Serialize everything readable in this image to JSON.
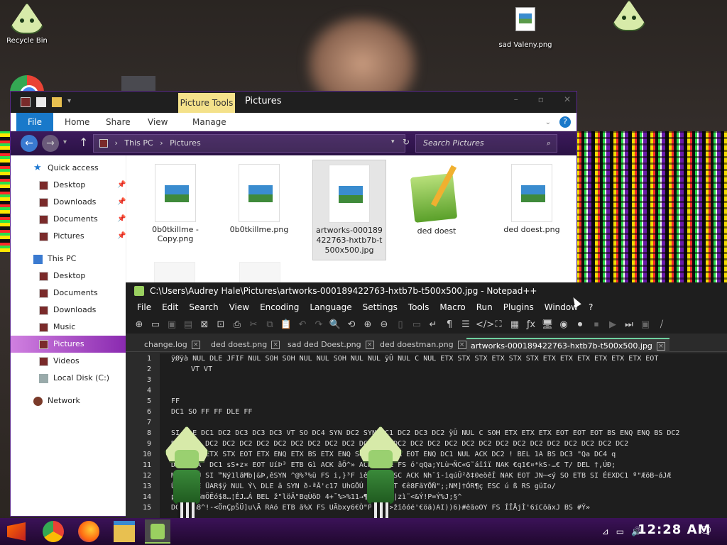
{
  "desktop": {
    "icons": [
      {
        "label": "Recycle Bin"
      },
      {
        "label": "sad Valeny.png"
      }
    ]
  },
  "explorer": {
    "ribbon_context_tab": "Picture Tools",
    "title": "Pictures",
    "ribbon_tabs": {
      "file": "File",
      "home": "Home",
      "share": "Share",
      "view": "View",
      "manage": "Manage"
    },
    "breadcrumb": {
      "this_pc": "This PC",
      "separator": "›",
      "pictures": "Pictures"
    },
    "search_placeholder": "Search Pictures",
    "nav": {
      "quick_access": "Quick access",
      "qa_items": [
        "Desktop",
        "Downloads",
        "Documents",
        "Pictures"
      ],
      "this_pc": "This PC",
      "pc_items": [
        "Desktop",
        "Documents",
        "Downloads",
        "Music",
        "Pictures",
        "Videos",
        "Local Disk (C:)"
      ],
      "network": "Network"
    },
    "files": [
      {
        "name": "0b0tkillme - Copy.png"
      },
      {
        "name": "0b0tkillme.png"
      },
      {
        "name": "artworks-000189422763-hxtb7b-t500x500.jpg"
      },
      {
        "name": "ded doest"
      },
      {
        "name": "ded doest.png"
      }
    ]
  },
  "notepad": {
    "title": "C:\\Users\\Audrey Hale\\Pictures\\artworks-000189422763-hxtb7b-t500x500.jpg - Notepad++",
    "menu": [
      "File",
      "Edit",
      "Search",
      "View",
      "Encoding",
      "Language",
      "Settings",
      "Tools",
      "Macro",
      "Run",
      "Plugins",
      "Window",
      "?"
    ],
    "tabs": [
      {
        "label": "change.log"
      },
      {
        "label": "ded doest.png"
      },
      {
        "label": "sad ded Doest.png"
      },
      {
        "label": "ded doestman.png"
      },
      {
        "label": "artworks-000189422763-hxtb7b-t500x500.jpg"
      }
    ],
    "lines": [
      {
        "n": "1",
        "text": "ÿØÿà NUL DLE JFIF NUL SOH SOH NUL NUL SOH NUL NUL ÿÛ NUL C NUL ETX STX STX ETX STX STX ETX ETX ETX ETX ETX ETX EOT"
      },
      {
        "n": "2",
        "text": "VT VT"
      },
      {
        "n": "3",
        "text": ""
      },
      {
        "n": "4",
        "text": ""
      },
      {
        "n": "5",
        "text": "FF"
      },
      {
        "n": "6",
        "text": "DC1 SO FF FF DLE FF"
      },
      {
        "n": "7",
        "text": ""
      },
      {
        "n": "8",
        "text": "SI DLE DC1 DC2 DC3 DC3 DC3 VT SO DC4 SYN DC2 SYN DC1 DC2 DC3 DC2 ÿÛ NUL C SOH ETX ETX ETX EOT EOT EOT BS ENQ ENQ BS DC2"
      },
      {
        "n": "9",
        "text": "DC2 DC2 DC2 DC2 DC2 DC2 DC2 DC2 DC2 DC2 DC2 DC2 DC2 DC2 DC2 DC2 DC2 DC2 DC2 DC2 DC2 DC2 DC2 DC2 DC2 DC2 DC2"
      },
      {
        "n": "10",
        "text": "NUL SOH ETX STX EOT ETX ENQ ETX BS ETX ENQ SOH STX ETX EOT ENQ DC1 NUL ACK DC2 ! BEL 1A BS DC3 \"Qa DC4 q"
      },
      {
        "n": "11",
        "text": "DC4 >óÂ¨ DC1 sS•z¤ EOT UíÞ³ ETB Gì ACK âÕ^» ACK ß1ºŒ FS ó'qQa;YLù¬ÑC«G˜áïîï NAK €q1€¤*kS-…€ T/ DEL †,ÚÐ;"
      },
      {
        "n": "12",
        "text": "MÉÕ6¤ûÚ SI ™Ný1lãMb|&Þ,êSYN ^@%³%ü FS i,}³F ìêPW=± ESC ACK Nh¨î-ìqúÛ²ð‡0eöêÍ NAK EOT JN~<ý SO ETB SI ÉEXDC1 º\"ÆöB~áJÆ"
      },
      {
        "n": "13",
        "text": "ÛSR DLE ÜAR$ÿ NUL Ý\\ DLE ã SYN ð-ªÂ'c17 UhGÕÚ SOH &VT €ê8FãYÕÑ\";;NM]†ÓR¶ç ESC ú ß RS güIo/"
      },
      {
        "n": "14",
        "text": "pÒb›§âGmÖËó$8…¦ÉJ…Á BEL ž\"löÃ\"BqÙöD 4+¯%>%11→¶RŽé*B,|zì¨<&Ý!P=Ý%J;§^"
      },
      {
        "n": "15",
        "text": "DC2 1ã8^!-<ÖnÇpŠÜ]u\\Ã RAó ETB ã%X FS UÃbxy6€Ò\"PåØƒr>žïôóé'€öä)AI))6)#êãoOY FS ÍÎÅjÌ'6íCöãxJ BS #Ý»"
      }
    ]
  },
  "taskbar": {
    "clock": "12:28 AM"
  }
}
